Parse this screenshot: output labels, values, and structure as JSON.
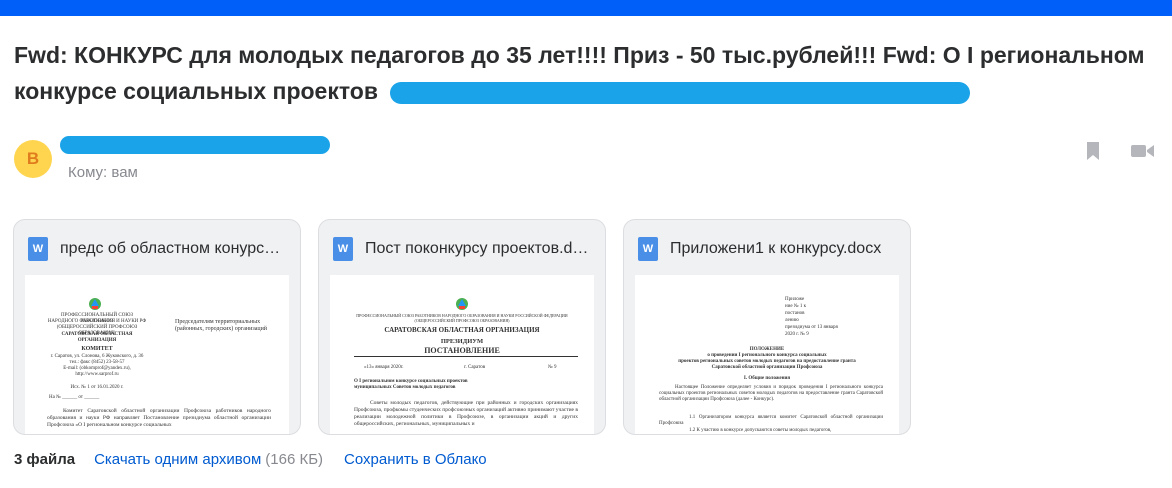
{
  "subject": {
    "line1": "Fwd: КОНКУРС для молодых педагогов до 35 лет!!!! Приз - 50 тыс.рублей!!! Fwd: О I региональном",
    "line2": "конкурсе социальных проектов"
  },
  "sender": {
    "avatar_letter": "В",
    "to_label": "Кому: вам"
  },
  "actions": {
    "bookmark_icon": "bookmark-icon",
    "video_icon": "video-call-icon"
  },
  "attachments": [
    {
      "name": "предс об областном конурсе.docx",
      "icon": "W",
      "preview": {
        "org_lines": [
          "ПРОФЕССИОНАЛЬНЫЙ СОЮЗ РАБОТНИКОВ",
          "НАРОДНОГО ОБРАЗОВАНИЯ И НАУКИ РФ",
          "(ОБЩЕРОССИЙСКИЙ ПРОФСОЮЗ ОБРАЗОВАНИЯ)",
          "САРАТОВСКАЯ ОБЛАСТНАЯ",
          "ОРГАНИЗАЦИЯ"
        ],
        "committee": "КОМИТЕТ",
        "address": [
          "г. Саратов, ул. Слонова, 6 Жуковского, д. 36",
          "тел.: факс (8452) 23-58-57",
          "E-mail: (obkomprof@yandex.ru), http://www.sarprof.ru"
        ],
        "recipients": [
          "Председателям территориальных",
          "(районных, городских) организаций"
        ],
        "ref": "Исх. № 1 от 16.01.2020 г.",
        "ref2": "На № ______ от ______",
        "body": "Комитет Саратовской областной организации Профсоюза работников народного образования и науки РФ направляет Постановление президиума областной организации Профсоюза «О I региональном конкурсе социальных"
      }
    },
    {
      "name": "Пост поконкурсу проектов.docx",
      "icon": "W",
      "preview": {
        "org_small": [
          "ПРОФЕССИОНАЛЬНЫЙ СОЮЗ РАБОТНИКОВ НАРОДНОГО ОБРАЗОВАНИЯ И НАУКИ РОССИЙСКОЙ ФЕДЕРАЦИИ",
          "(ОБЩЕРОССИЙСКИЙ ПРОФСОЮЗ ОБРАЗОВАНИЯ)"
        ],
        "org_title": "САРАТОВСКАЯ ОБЛАСТНАЯ ОРГАНИЗАЦИЯ",
        "presidium": "ПРЕЗИДИУМ",
        "decree": "ПОСТАНОВЛЕНИЕ",
        "date": "«13» января 2020г.",
        "city": "г. Саратов",
        "number": "№ 9",
        "topic": [
          "О I региональном конкурсе социальных проектов",
          "муниципальных Советов молодых педагогов"
        ],
        "body": "Советы молодых педагогов, действующие при районных и городских организациях Профсоюза, профкомы студенческих профсоюзных организаций активно принимают участие в реализации молодежной политики в Профсоюзе, в организации акций и других общероссийских, региональных, муниципальных и"
      }
    },
    {
      "name": "Приложени1 к конкурсу.docx",
      "icon": "W",
      "preview": {
        "appendix": [
          "Приложе",
          "ние № 1 к",
          "постанов",
          "лению",
          "президиума от 13 января",
          "2020 г. № 9"
        ],
        "title": "ПОЛОЖЕНИЕ",
        "subtitle": [
          "о проведении I регионального конкурса социальных",
          "проектов региональных советов молодых педагогов на предоставление гранта",
          "Саратовской областной организации Профсоюза"
        ],
        "section": "I. Общие положения",
        "body": "Настоящее Положение определяет условия и порядок проведения I регионального конкурса социальных проектов региональных советов молодых педагогов на предоставление гранта Саратовской областной организации Профсоюза (далее - Конкурс).",
        "item1": "1.1 Организатором конкурса является комитет Саратовской областной организации Профсоюза",
        "item2": "1.2 К участию в конкурсе допускаются советы молодых педагогов,"
      }
    }
  ],
  "footer": {
    "count": "3 файла",
    "download_label": "Скачать одним архивом",
    "size": "(166 КБ)",
    "cloud_label": "Сохранить в Облако"
  }
}
